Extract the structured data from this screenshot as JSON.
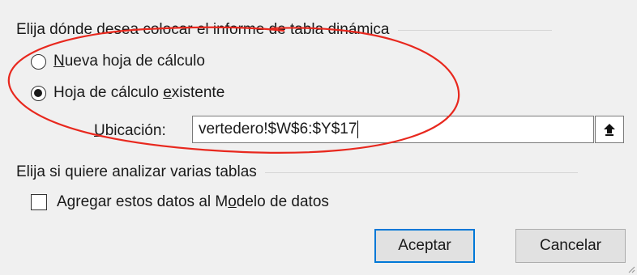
{
  "placement": {
    "title": "Elija dónde desea colocar el informe de tabla dinámica",
    "option_new": {
      "pre": "",
      "mn": "N",
      "post": "ueva hoja de cálculo",
      "checked": false
    },
    "option_existing": {
      "pre": "Hoja de cálculo ",
      "mn": "e",
      "post": "xistente",
      "checked": true
    },
    "location": {
      "mn": "U",
      "post": "bicación:",
      "value": "vertedero!$W$6:$Y$17"
    }
  },
  "analysis": {
    "title": "Elija si quiere analizar varias tablas",
    "checkbox": {
      "pre": "Agregar estos datos al M",
      "mn": "o",
      "post": "delo de datos",
      "checked": false
    }
  },
  "buttons": {
    "ok": "Aceptar",
    "cancel": "Cancelar"
  },
  "icons": {
    "collapse": "collapse-dialog-icon"
  },
  "colors": {
    "annotation": "#e8281e",
    "default_button_border": "#0078d7"
  }
}
